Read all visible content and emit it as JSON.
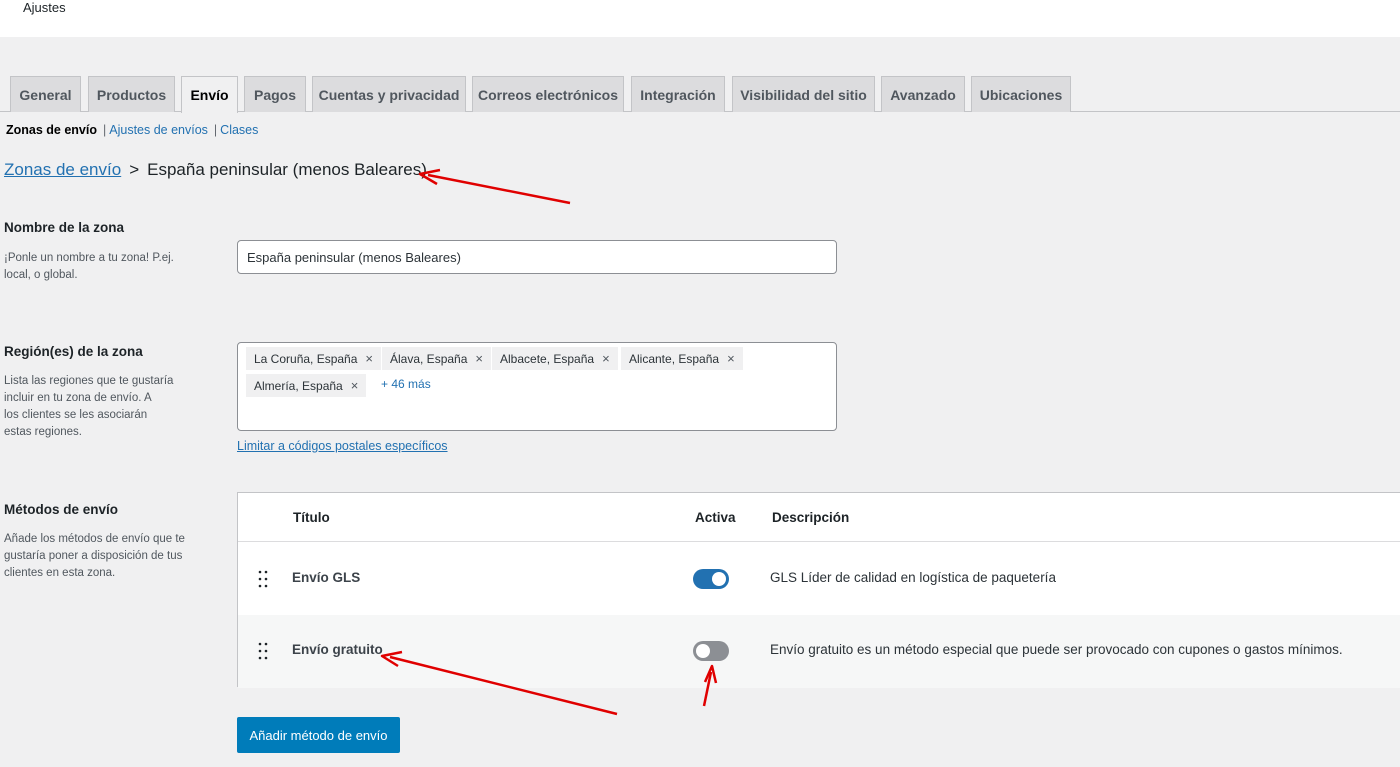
{
  "header": {
    "title": "Ajustes"
  },
  "tabs": [
    {
      "label": "General"
    },
    {
      "label": "Productos"
    },
    {
      "label": "Envío"
    },
    {
      "label": "Pagos"
    },
    {
      "label": "Cuentas y privacidad"
    },
    {
      "label": "Correos electrónicos"
    },
    {
      "label": "Integración"
    },
    {
      "label": "Visibilidad del sitio"
    },
    {
      "label": "Avanzado"
    },
    {
      "label": "Ubicaciones"
    }
  ],
  "active_tab": "Envío",
  "subnav": {
    "current": "Zonas de envío",
    "links": [
      "Ajustes de envíos",
      "Clases"
    ],
    "separator": "|"
  },
  "breadcrumb": {
    "parent": "Zonas de envío",
    "separator": ">",
    "current": "España peninsular (menos Baleares)"
  },
  "zone_name": {
    "label": "Nombre de la zona",
    "help": [
      "¡Ponle un nombre a tu zona! P.ej.",
      "local, o global."
    ],
    "value": "España peninsular (menos Baleares)"
  },
  "zone_regions": {
    "label": "Región(es) de la zona",
    "help": [
      "Lista las regiones que te gustaría",
      "incluir en tu zona de envío. A",
      "los clientes se les asociarán",
      "estas regiones."
    ],
    "chips": [
      "La Coruña, España",
      "Álava, España",
      "Albacete, España",
      "Alicante, España",
      "Almería, España"
    ],
    "remove_glyph": "×",
    "more": "+ 46 más",
    "postal_link": "Limitar a códigos postales específicos"
  },
  "shipping_methods": {
    "label": "Métodos de envío",
    "help": [
      "Añade los métodos de envío que te",
      "gustaría poner a disposición de tus",
      "clientes en esta zona."
    ],
    "columns": {
      "title": "Título",
      "active": "Activa",
      "description": "Descripción"
    },
    "rows": [
      {
        "title": "Envío GLS",
        "active": true,
        "description": "GLS Líder de calidad en logística de paquetería"
      },
      {
        "title": "Envío gratuito",
        "active": false,
        "description": "Envío gratuito es un método especial que puede ser provocado con cupones o gastos mínimos."
      }
    ],
    "add_button": "Añadir método de envío"
  },
  "colors": {
    "accent": "#2271b1",
    "button": "#007cba",
    "toggle_on": "#2271b1",
    "toggle_off": "#8c8f94",
    "annotation_arrow": "#e00000"
  }
}
